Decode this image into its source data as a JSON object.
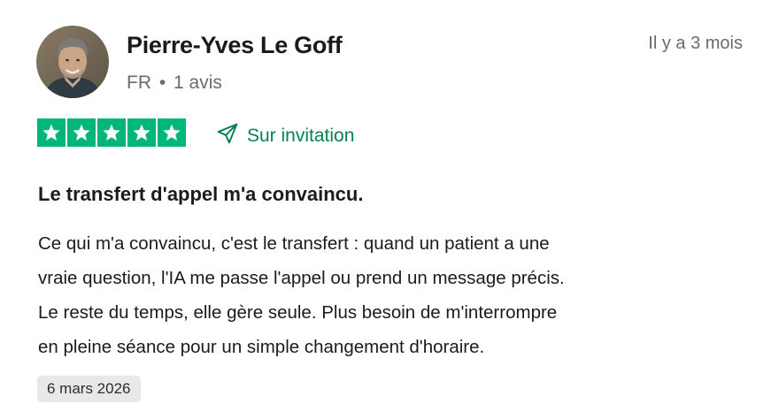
{
  "reviewer": {
    "name": "Pierre-Yves Le Goff",
    "country": "FR",
    "separator": "•",
    "review_count": "1 avis"
  },
  "relative_date": "Il y a 3 mois",
  "rating": {
    "stars": 5,
    "max": 5,
    "color": "#00b67a"
  },
  "invitation": {
    "label": "Sur invitation",
    "icon": "paper-plane-icon",
    "color": "#04824f"
  },
  "review": {
    "title": "Le transfert d'appel m'a convaincu.",
    "lines": [
      "Ce qui m'a convaincu, c'est le transfert : quand un patient a une",
      "vraie question, l'IA me passe l'appel ou prend un message précis.",
      "Le reste du temps, elle gère seule. Plus besoin de m'interrompre",
      "en pleine séance pour un simple changement d'horaire."
    ]
  },
  "experience_date": "6 mars 2026"
}
